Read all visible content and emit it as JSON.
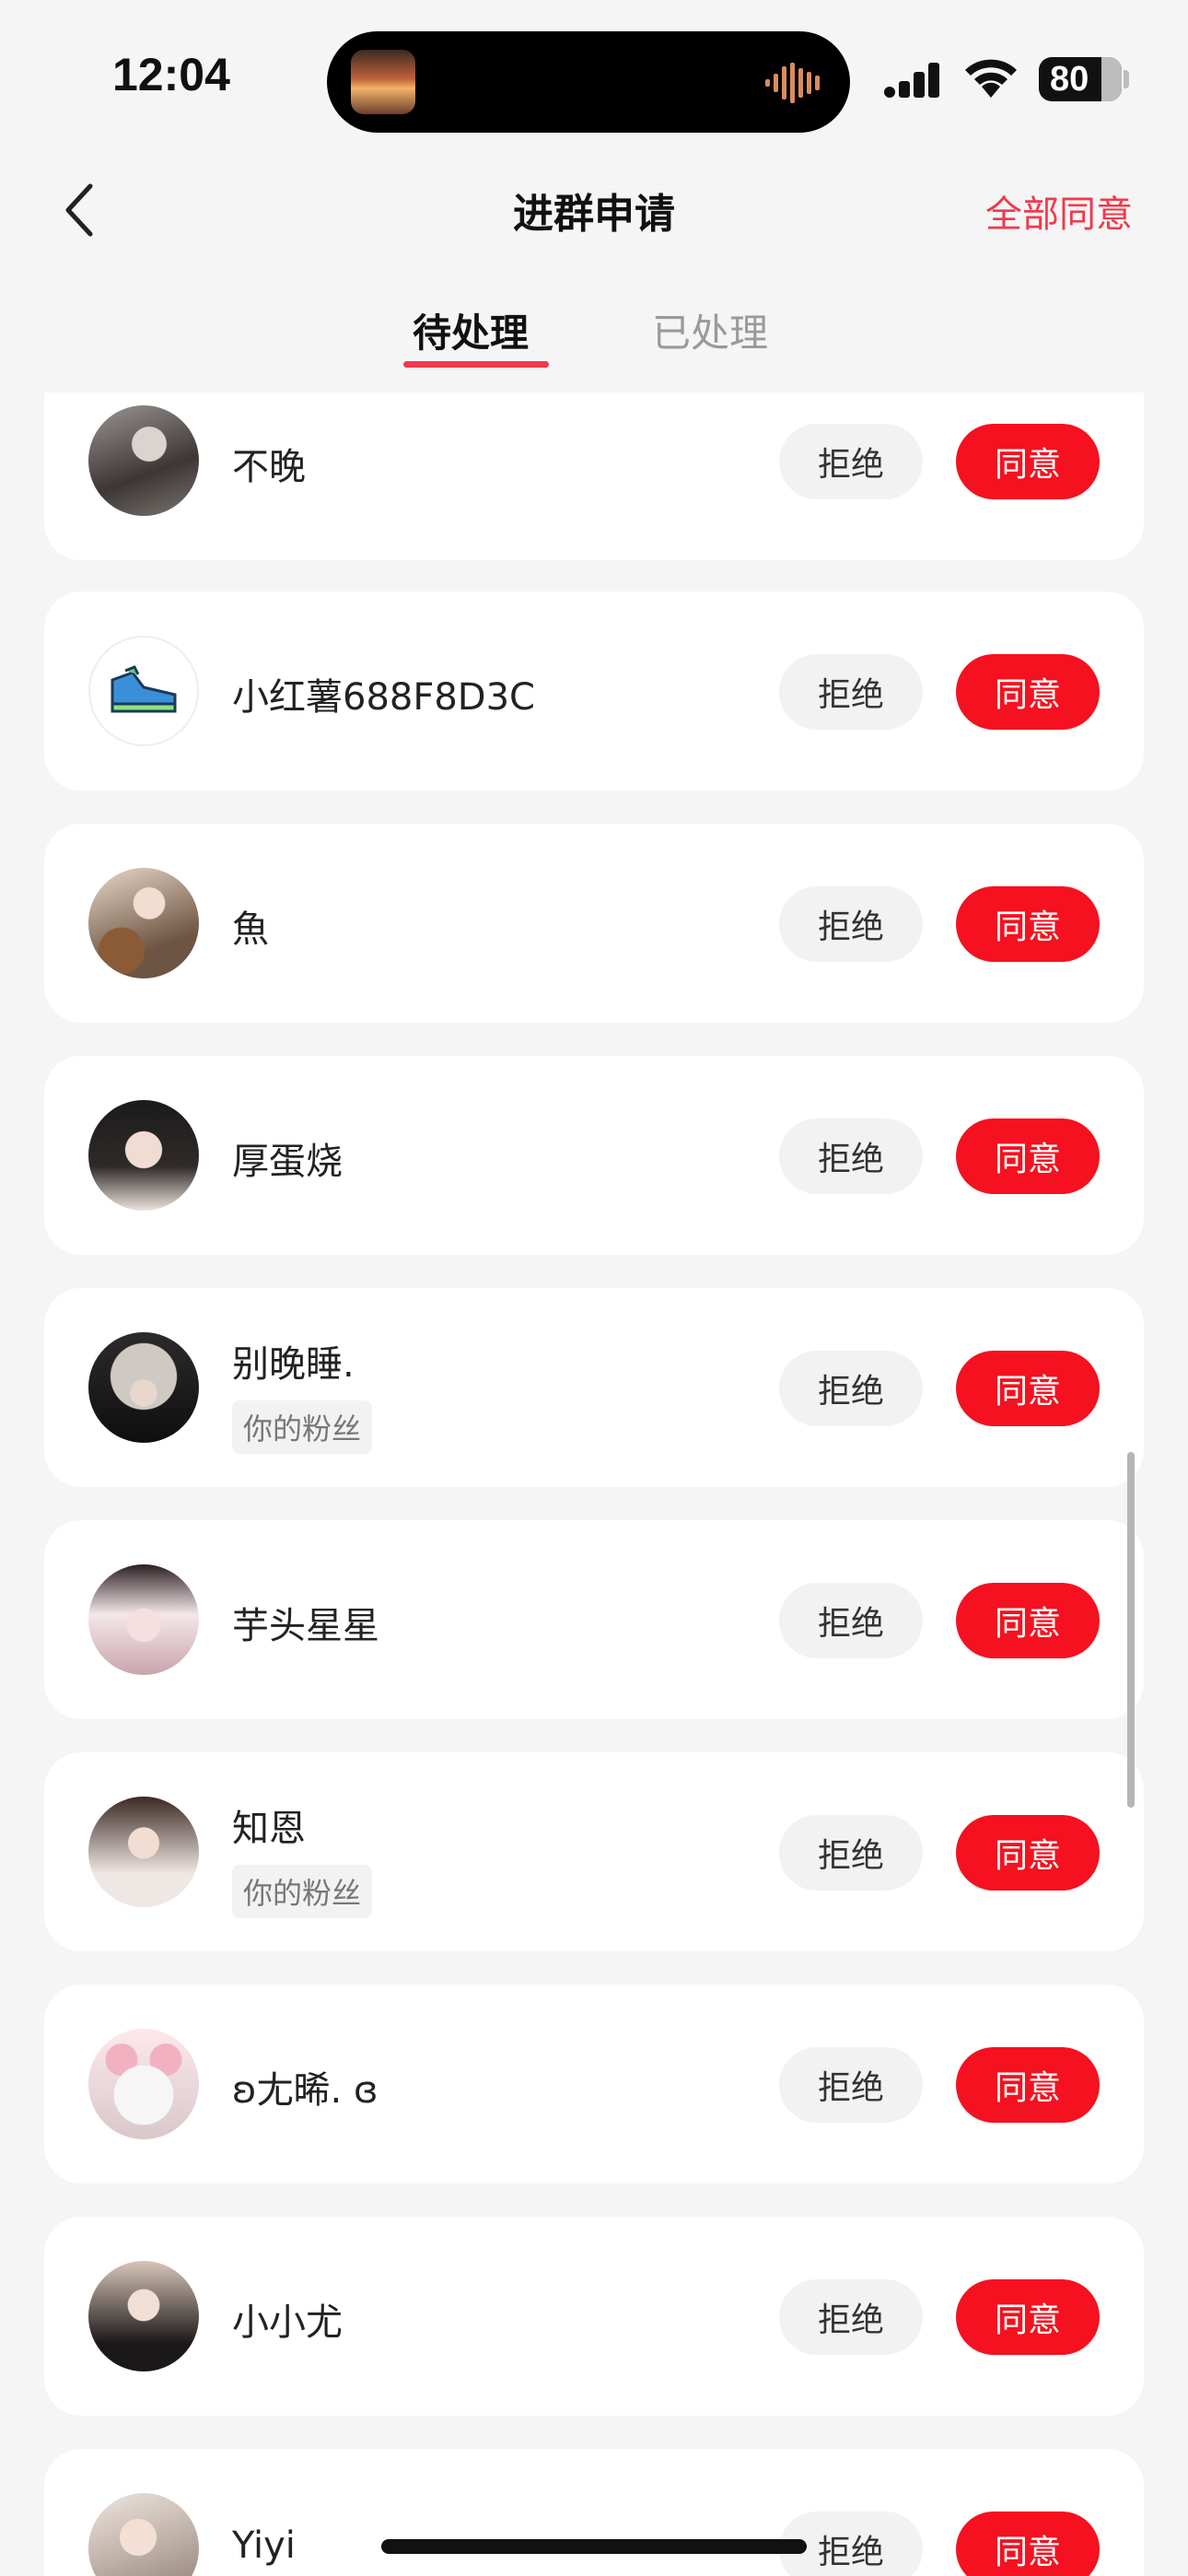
{
  "status_bar": {
    "time": "12:04",
    "battery": "80"
  },
  "nav": {
    "title": "进群申请",
    "approve_all": "全部同意"
  },
  "tabs": [
    {
      "label": "待处理",
      "active": true
    },
    {
      "label": "已处理",
      "active": false
    }
  ],
  "actions": {
    "reject": "拒绝",
    "accept": "同意"
  },
  "requests": [
    {
      "name": "不晚",
      "tag": ""
    },
    {
      "name": "小红薯688F8D3C",
      "tag": ""
    },
    {
      "name": "魚",
      "tag": ""
    },
    {
      "name": "厚蛋烧",
      "tag": ""
    },
    {
      "name": "别晚睡.",
      "tag": "你的粉丝"
    },
    {
      "name": "芋头星星",
      "tag": ""
    },
    {
      "name": "知恩",
      "tag": "你的粉丝"
    },
    {
      "name": "ʚ尢晞. ɞ",
      "tag": ""
    },
    {
      "name": "小小尤",
      "tag": ""
    },
    {
      "name": "Yiyi",
      "tag": ""
    }
  ],
  "colors": {
    "accent": "#f03a4b",
    "accept_button": "#f5111f",
    "background": "#f5f5f5"
  }
}
